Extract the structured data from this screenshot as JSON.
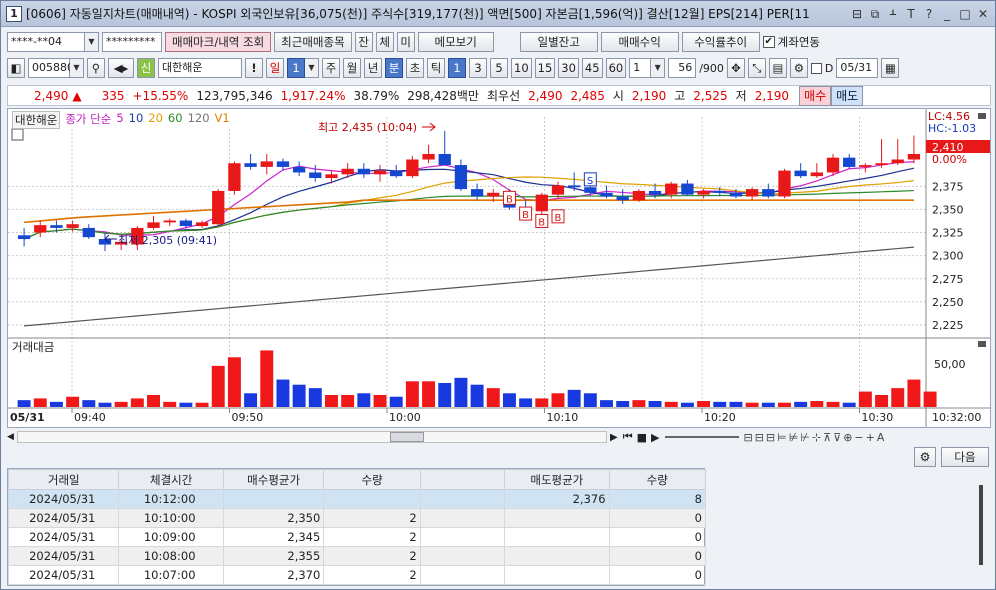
{
  "window": {
    "number": "1",
    "title": "[0606] 자동일지차트(매매내역) - KOSPI 외국인보유[36,075(천)] 주식수[319,177(천)] 액면[500] 자본금[1,596(억)] 결산[12월] EPS[214] PER[11",
    "buttons": [
      "⊟",
      "⧉",
      "ᚆ",
      "T",
      "?",
      "_",
      "□",
      "✕"
    ]
  },
  "row1": {
    "account": "****-**04",
    "password": "*********",
    "trade_mark_btn": "매매마크/내역 조회",
    "recent_btn": "최근매매종목",
    "jan": "잔",
    "che": "체",
    "mi": "미",
    "memo": "메모보기",
    "daily_balance": "일별잔고",
    "trade_profit": "매매수익",
    "return_trend": "수익률추이",
    "link_check": "계좌연동"
  },
  "row2": {
    "code": "005880",
    "sin": "신",
    "name": "대한해운",
    "excl": "!",
    "day": "일",
    "period_n": "1",
    "ju": "주",
    "wol": "월",
    "nyeon": "년",
    "bun": "분",
    "cho": "초",
    "tick": "틱",
    "mins": [
      "1",
      "3",
      "5",
      "10",
      "15",
      "30",
      "45",
      "60"
    ],
    "count": "1",
    "bars": "56",
    "total": "/900",
    "d_label": "D",
    "date": "05/31"
  },
  "quote": {
    "price": "2,490",
    "arrow": "▲",
    "change": "335",
    "pct": "+15.55%",
    "volume": "123,795,346",
    "vol_ratio": "1,917.24%",
    "turnover": "38.79%",
    "amount": "298,428백만",
    "best_label": "최우선",
    "ask": "2,490",
    "bid": "2,485",
    "open_l": "시",
    "open": "2,190",
    "high_l": "고",
    "high": "2,525",
    "low_l": "저",
    "low": "2,190",
    "buy_btn": "매수",
    "sell_btn": "매도"
  },
  "chart": {
    "legend_name": "대한해운",
    "legend_ma": "종가 단순",
    "ma": [
      "5",
      "10",
      "20",
      "60",
      "120"
    ],
    "legend_v": "V1",
    "max_label": "최고 2,435 (10:04)",
    "min_label": "최저 2,305 (09:41)",
    "lc": "LC:4.56",
    "hc": "HC:-1.03",
    "last_label": "2,410",
    "zero_label": "0.00%",
    "y_ticks": [
      "2,375",
      "2,350",
      "2,325",
      "2,300",
      "2,275",
      "2,250",
      "2,225"
    ],
    "vol_title": "거래대금",
    "vol_tick": "50,00",
    "date_label": "05/31",
    "x_ticks": [
      "09:40",
      "09:50",
      "10:00",
      "10:10",
      "10:20",
      "10:30"
    ],
    "x_end": "10:32:00",
    "marks": [
      "S",
      "B",
      "B",
      "B",
      "B"
    ]
  },
  "grid": {
    "next_btn": "다음",
    "headers": [
      "거래일",
      "체결시간",
      "매수평균가",
      "수량",
      "",
      "매도평균가",
      "수량"
    ],
    "rows": [
      [
        "2024/05/31",
        "10:12:00",
        "",
        "",
        "",
        "2,376",
        "8"
      ],
      [
        "2024/05/31",
        "10:10:00",
        "2,350",
        "2",
        "",
        "",
        "0"
      ],
      [
        "2024/05/31",
        "10:09:00",
        "2,345",
        "2",
        "",
        "",
        "0"
      ],
      [
        "2024/05/31",
        "10:08:00",
        "2,355",
        "2",
        "",
        "",
        "0"
      ],
      [
        "2024/05/31",
        "10:07:00",
        "2,370",
        "2",
        "",
        "",
        "0"
      ]
    ]
  },
  "chart_data": {
    "type": "candlestick",
    "title": "대한해운",
    "ylim": [
      2212,
      2450
    ],
    "last": 2410,
    "candles": [
      [
        2322,
        2330,
        2310,
        2318
      ],
      [
        2325,
        2338,
        2320,
        2333
      ],
      [
        2333,
        2338,
        2325,
        2330
      ],
      [
        2330,
        2338,
        2326,
        2334
      ],
      [
        2330,
        2334,
        2318,
        2320
      ],
      [
        2318,
        2325,
        2305,
        2312
      ],
      [
        2312,
        2318,
        2306,
        2315
      ],
      [
        2312,
        2332,
        2306,
        2330
      ],
      [
        2330,
        2343,
        2328,
        2336
      ],
      [
        2336,
        2340,
        2332,
        2338
      ],
      [
        2338,
        2340,
        2330,
        2332
      ],
      [
        2332,
        2338,
        2330,
        2336
      ],
      [
        2334,
        2372,
        2332,
        2370
      ],
      [
        2370,
        2402,
        2366,
        2400
      ],
      [
        2400,
        2410,
        2393,
        2396
      ],
      [
        2396,
        2410,
        2388,
        2402
      ],
      [
        2402,
        2405,
        2392,
        2396
      ],
      [
        2396,
        2402,
        2386,
        2390
      ],
      [
        2390,
        2398,
        2380,
        2384
      ],
      [
        2384,
        2392,
        2378,
        2388
      ],
      [
        2388,
        2400,
        2384,
        2394
      ],
      [
        2394,
        2400,
        2384,
        2388
      ],
      [
        2388,
        2398,
        2380,
        2392
      ],
      [
        2392,
        2398,
        2384,
        2386
      ],
      [
        2386,
        2408,
        2384,
        2404
      ],
      [
        2404,
        2420,
        2400,
        2410
      ],
      [
        2410,
        2435,
        2404,
        2398
      ],
      [
        2398,
        2404,
        2370,
        2372
      ],
      [
        2372,
        2378,
        2360,
        2364
      ],
      [
        2364,
        2372,
        2358,
        2368
      ],
      [
        2368,
        2372,
        2350,
        2352
      ],
      [
        2352,
        2360,
        2344,
        2348
      ],
      [
        2348,
        2368,
        2345,
        2366
      ],
      [
        2366,
        2380,
        2362,
        2376
      ],
      [
        2376,
        2390,
        2370,
        2374
      ],
      [
        2374,
        2382,
        2364,
        2368
      ],
      [
        2368,
        2376,
        2362,
        2364
      ],
      [
        2364,
        2372,
        2356,
        2360
      ],
      [
        2360,
        2372,
        2358,
        2370
      ],
      [
        2370,
        2378,
        2362,
        2366
      ],
      [
        2366,
        2380,
        2362,
        2378
      ],
      [
        2378,
        2382,
        2365,
        2366
      ],
      [
        2366,
        2372,
        2362,
        2370
      ],
      [
        2370,
        2374,
        2364,
        2368
      ],
      [
        2368,
        2372,
        2362,
        2364
      ],
      [
        2364,
        2374,
        2360,
        2372
      ],
      [
        2372,
        2378,
        2362,
        2364
      ],
      [
        2364,
        2394,
        2362,
        2392
      ],
      [
        2392,
        2400,
        2384,
        2386
      ],
      [
        2386,
        2400,
        2384,
        2390
      ],
      [
        2390,
        2410,
        2386,
        2406
      ],
      [
        2406,
        2410,
        2394,
        2396
      ],
      [
        2396,
        2400,
        2390,
        2398
      ],
      [
        2398,
        2426,
        2395,
        2400
      ],
      [
        2400,
        2426,
        2398,
        2404
      ],
      [
        2404,
        2430,
        2400,
        2410
      ]
    ],
    "volume": [
      8,
      10,
      6,
      12,
      8,
      5,
      6,
      10,
      14,
      6,
      5,
      5,
      48,
      58,
      16,
      66,
      32,
      26,
      22,
      14,
      14,
      16,
      14,
      12,
      30,
      30,
      28,
      34,
      26,
      22,
      16,
      10,
      10,
      16,
      20,
      16,
      8,
      7,
      8,
      7,
      6,
      5,
      7,
      6,
      6,
      5,
      5,
      5,
      6,
      7,
      6,
      5,
      18,
      14,
      22,
      32,
      18
    ]
  }
}
